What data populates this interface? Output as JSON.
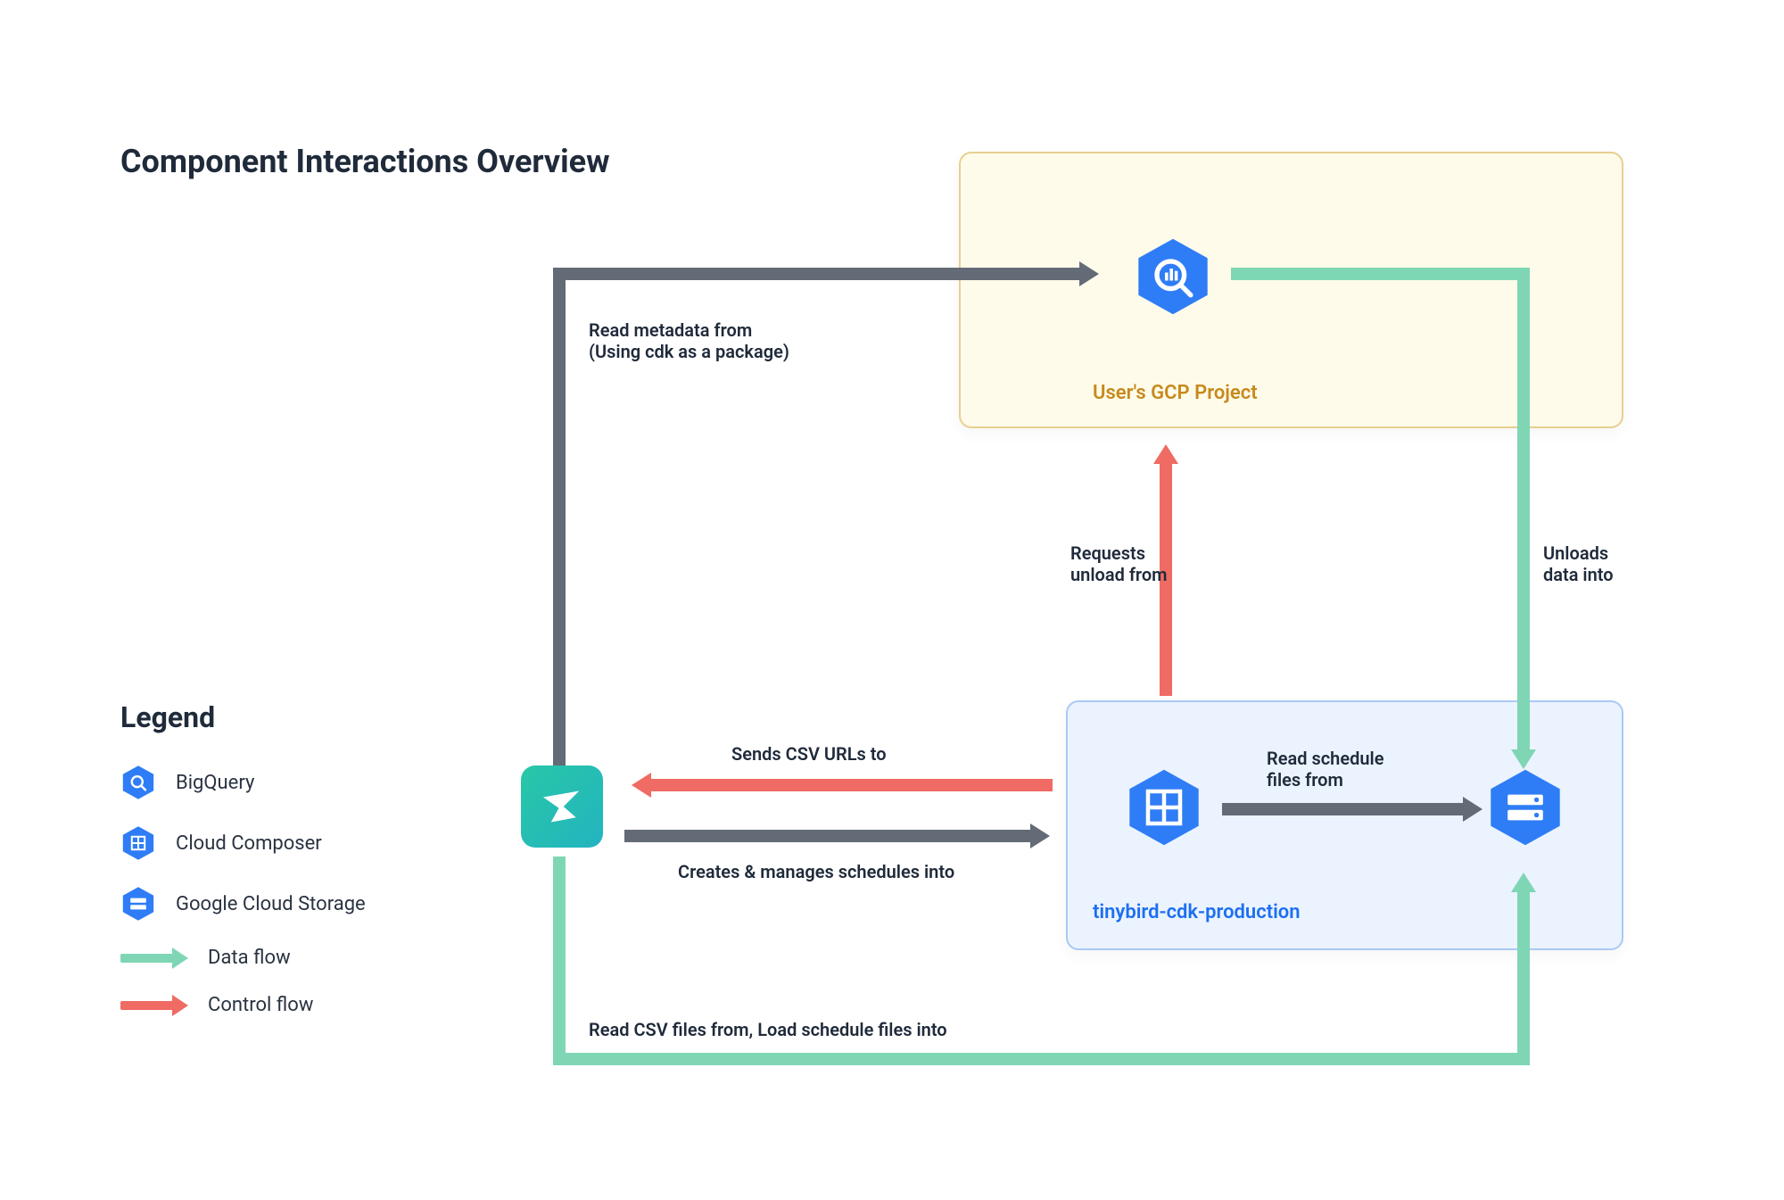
{
  "title": "Component Interactions Overview",
  "legend": {
    "title": "Legend",
    "items": [
      {
        "icon": "bigquery-icon",
        "label": "BigQuery"
      },
      {
        "icon": "cloud-composer-icon",
        "label": "Cloud Composer"
      },
      {
        "icon": "gcs-icon",
        "label": "Google Cloud Storage"
      },
      {
        "icon": "data-flow-arrow",
        "label": "Data flow"
      },
      {
        "icon": "control-flow-arrow",
        "label": "Control flow"
      }
    ]
  },
  "groups": {
    "user_gcp": {
      "label": "User's GCP Project"
    },
    "tinybird_cdk": {
      "label": "tinybird-cdk-production"
    }
  },
  "nodes": {
    "bigquery": "BigQuery",
    "tinybird": "Tinybird",
    "composer": "Cloud Composer",
    "gcs": "Google Cloud Storage"
  },
  "flows": {
    "read_metadata": "Read metadata from\n(Using cdk as a package)",
    "sends_csv": "Sends CSV URLs to",
    "creates_manages": "Creates & manages schedules into",
    "requests_unload": "Requests\nunload from",
    "read_schedule": "Read schedule\nfiles from",
    "unloads_data": "Unloads\ndata into",
    "read_csv_load": "Read CSV files from, Load schedule files into"
  }
}
